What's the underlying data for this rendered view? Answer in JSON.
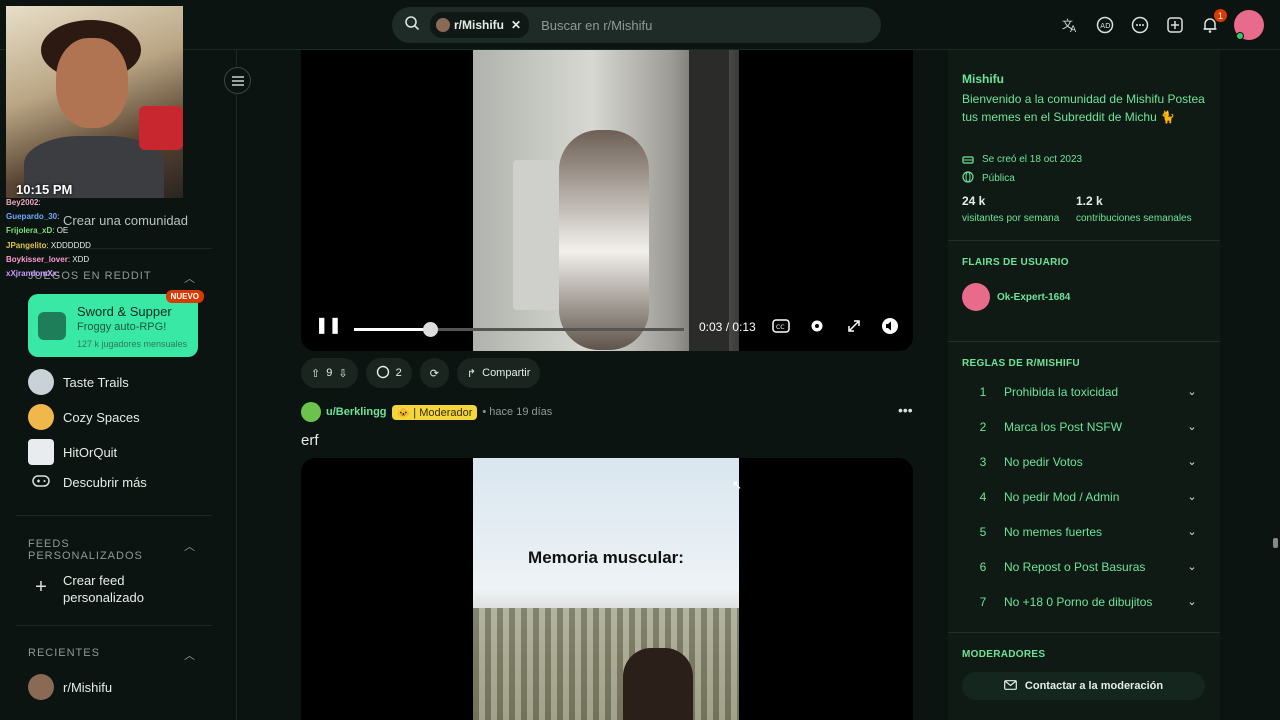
{
  "header": {
    "search_chip": "r/Mishifu",
    "search_placeholder": "Buscar en r/Mishifu",
    "notification_count": "1",
    "icons": [
      "translate-icon",
      "ad-icon",
      "chat-icon",
      "create-icon",
      "bell-icon"
    ]
  },
  "stream_overlay": {
    "time": "10:15 PM",
    "chat": [
      {
        "user": "Bey2002",
        "msg": ": "
      },
      {
        "user": "Guepardo_30",
        "msg": ": "
      },
      {
        "user": "Frijolera_xD",
        "msg": ": OE"
      },
      {
        "user": "JPangelito",
        "msg": ": XDDDDDD"
      },
      {
        "user": "Boykisser_lover",
        "msg": ": XDD"
      },
      {
        "user": "xXjrandomXx",
        "msg": ": "
      }
    ]
  },
  "sidebar": {
    "create_community": "Crear una comunidad",
    "games_section": "JUEGOS EN REDDIT",
    "promo": {
      "badge": "NUEVO",
      "title": "Sword & Supper",
      "subtitle": "Froggy auto-RPG!",
      "players": "127 k jugadores mensuales"
    },
    "games": [
      {
        "label": "Taste Trails",
        "color": "#c9d2d7"
      },
      {
        "label": "Cozy Spaces",
        "color": "#f0b74a"
      },
      {
        "label": "HitOrQuit",
        "color": "#e8ecef"
      },
      {
        "label": "Descubrir más"
      }
    ],
    "feeds_section": "FEEDS PERSONALIZADOS",
    "create_feed": "Crear feed personalizado",
    "recent_section": "RECIENTES",
    "recent": [
      {
        "label": "r/Mishifu"
      }
    ]
  },
  "post1": {
    "video_time": "0:03 / 0:13",
    "progress": 0.23,
    "votes": "9",
    "comments": "2",
    "share": "Compartir"
  },
  "post2": {
    "user": "u/Berklingg",
    "flair": "Moderador",
    "ago": "• hace 19 días",
    "title": "erf",
    "video_caption": "Memoria muscular:"
  },
  "right": {
    "name": "Mishifu",
    "description": "Bienvenido a la comunidad de Mishifu Postea tus memes en el Subreddit de Michu 🐈",
    "created": "Se creó el 18 oct 2023",
    "visibility": "Pública",
    "visitors": "24 k",
    "visitors_label": "visitantes por semana",
    "contributions": "1.2 k",
    "contributions_label": "contribuciones semanales",
    "flairs_section": "FLAIRS DE USUARIO",
    "flair_user": "Ok-Expert-1684",
    "rules_section": "REGLAS DE R/MISHIFU",
    "rules": [
      {
        "num": "1",
        "label": "Prohibida la toxicidad"
      },
      {
        "num": "2",
        "label": "Marca los Post NSFW"
      },
      {
        "num": "3",
        "label": "No pedir Votos"
      },
      {
        "num": "4",
        "label": "No pedir Mod / Admin"
      },
      {
        "num": "5",
        "label": "No memes fuertes"
      },
      {
        "num": "6",
        "label": "No Repost o Post Basuras"
      },
      {
        "num": "7",
        "label": "No +18 0 Porno de dibujitos"
      }
    ],
    "mods_section": "MODERADORES",
    "contact_mods": "Contactar a la moderación"
  },
  "colors": {
    "accent": "#6de39a",
    "promo": "#38e8a4",
    "background": "#0b1410",
    "badge": "#d93a00"
  }
}
